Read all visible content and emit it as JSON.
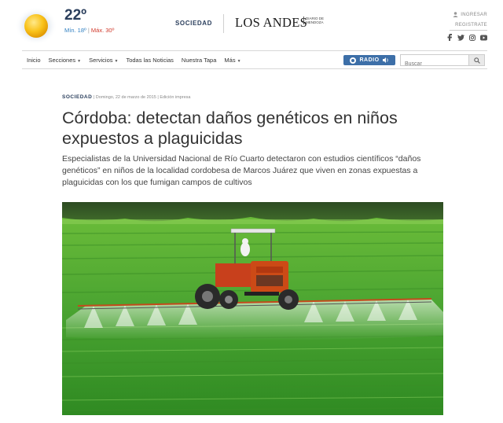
{
  "weather": {
    "icon": "sun-icon",
    "temperature": "22º",
    "min": "Mín. 18º",
    "separator": "|",
    "max": "Máx. 30º"
  },
  "header": {
    "section_label": "SOCIEDAD",
    "logo": "LOS ANDES",
    "logo_sub": "DIARIO DE MENDOZA",
    "login_label": "INGRESAR",
    "register_label": "REGISTRATE",
    "social_icons": [
      "facebook-icon",
      "twitter-icon",
      "instagram-icon",
      "youtube-icon"
    ]
  },
  "nav": {
    "items": [
      {
        "label": "Inicio",
        "caret": false
      },
      {
        "label": "Secciones",
        "caret": true
      },
      {
        "label": "Servicios",
        "caret": true
      },
      {
        "label": "Todas las Noticias",
        "caret": false
      },
      {
        "label": "Nuestra Tapa",
        "caret": false
      },
      {
        "label": "Más",
        "caret": true
      }
    ],
    "radio_label": "RADIO",
    "search_placeholder": "Buscar"
  },
  "article": {
    "section": "SOCIEDAD",
    "meta": "| Domingo, 22 de marzo de 2015 | Edición impresa",
    "title": "Córdoba: detectan daños genéticos en niños expuestos a plaguicidas",
    "lead": "Especialistas de la Universidad Nacional de Río Cuarto detectaron con estudios científicos “daños genéticos” en niños de la localidad cordobesa de Marcos Juárez que viven en zonas expuestas a plaguicidas con los que fumigan campos de cultivos"
  },
  "colors": {
    "brand_blue": "#2a3e5c",
    "radio_blue": "#3d6fa8",
    "min_temp": "#2f7fc1",
    "max_temp": "#d0392b",
    "field_green": "#4aa431"
  }
}
